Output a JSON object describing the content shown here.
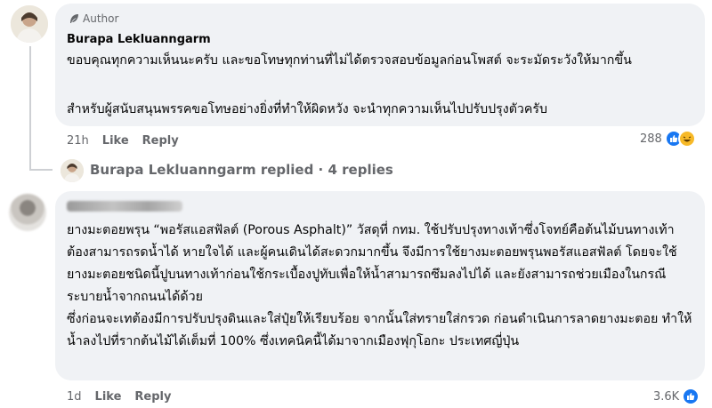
{
  "comment1": {
    "badge_label": "Author",
    "name": "Burapa Lekluanngarm",
    "paragraphs": [
      "ขอบคุณทุกความเห็นนะครับ และขอโทษทุกท่านที่ไม่ได้ตรวจสอบข้อมูลก่อนโพสต์ จะระมัดระวังให้มากขึ้น",
      "สำหรับผู้สนับสนุนพรรคขอโทษอย่างยิ่งที่ทำให้ผิดหวัง จะนำทุกความเห็นไปปรับปรุงตัวครับ"
    ],
    "time": "21h",
    "like_label": "Like",
    "reply_label": "Reply",
    "reaction_count": "288",
    "reactions": [
      "like-icon",
      "haha-icon"
    ]
  },
  "replies": {
    "text": "Burapa Lekluanngarm replied · 4 replies"
  },
  "comment2": {
    "paragraphs": [
      "ยางมะตอยพรุน “พอรัสแอสฟัลต์ (Porous Asphalt)” วัสดุที่ กทม. ใช้ปรับปรุงทางเท้าซึ่งโจทย์คือต้นไม้บนทางเท้าต้องสามารถรดน้ำได้ หายใจได้ และผู้คนเดินได้สะดวกมากขึ้น จึงมีการใช้ยางมะตอยพรุนพอรัสแอสฟัลต์ โดยจะใช้ยางมะตอยชนิดนี้ปูบนทางเท้าก่อนใช้กระเบื้องปูทับเพื่อให้น้ำสามารถซึมลงไปได้ และยังสามารถช่วยเมืองในกรณีระบายน้ำจากถนนได้ด้วย",
      "ซึ่งก่อนจะเทต้องมีการปรับปรุงดินและใส่ปุ๋ยให้เรียบร้อย จากนั้นใส่ทรายใส่กรวด ก่อนดำเนินการลาดยางมะตอย ทำให้น้ำลงไปที่รากต้นไม้ได้เต็มที่ 100% ซึ่งเทคนิคนี้ได้มาจากเมืองฟุกุโอกะ ประเทศญี่ปุ่น"
    ],
    "time": "1d",
    "like_label": "Like",
    "reply_label": "Reply",
    "reaction_count": "3.6K",
    "reactions": [
      "like-icon"
    ]
  },
  "colors": {
    "bubble": "#f0f2f5",
    "meta": "#65676b",
    "like": "#1877f2",
    "haha": "#f7b928"
  }
}
